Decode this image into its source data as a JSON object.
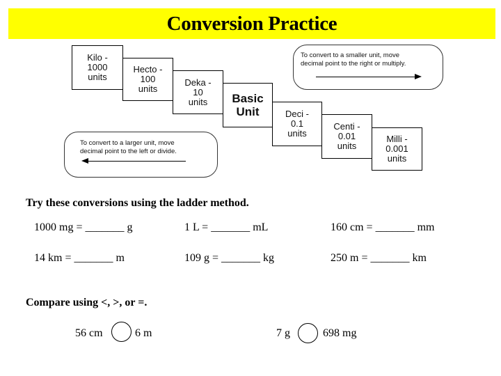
{
  "title": "Conversion Practice",
  "ladder": {
    "boxes": [
      {
        "name": "Kilo",
        "line1": "Kilo -",
        "line2": "1000",
        "line3": "units"
      },
      {
        "name": "Hecto",
        "line1": "Hecto -",
        "line2": "100",
        "line3": "units"
      },
      {
        "name": "Deka",
        "line1": "Deka -",
        "line2": "10",
        "line3": "units"
      },
      {
        "name": "Basic",
        "line1": "Basic",
        "line2": "Unit"
      },
      {
        "name": "Deci",
        "line1": "Deci -",
        "line2": "0.1",
        "line3": "units"
      },
      {
        "name": "Centi",
        "line1": "Centi -",
        "line2": "0.01",
        "line3": "units"
      },
      {
        "name": "Milli",
        "line1": "Milli -",
        "line2": "0.001",
        "line3": "units"
      }
    ],
    "smaller_note": {
      "line1": "To convert to a smaller unit, move",
      "line2": "decimal  point to the right or multiply."
    },
    "larger_note": {
      "line1": "To convert to a larger unit, move",
      "line2": "decimal  point to the left or divide."
    }
  },
  "practice": {
    "heading": "Try these conversions using the ladder method.",
    "problems": [
      "1000 mg = _______ g",
      "1 L = _______ mL",
      "160 cm = _______ mm",
      "14 km = _______ m",
      "109 g = _______ kg",
      "250 m = _______ km"
    ]
  },
  "compare": {
    "heading": "Compare using <, >, or =.",
    "pairs": [
      {
        "left": "56 cm",
        "right": "6 m"
      },
      {
        "left": "7 g",
        "right": "698 mg"
      }
    ]
  }
}
